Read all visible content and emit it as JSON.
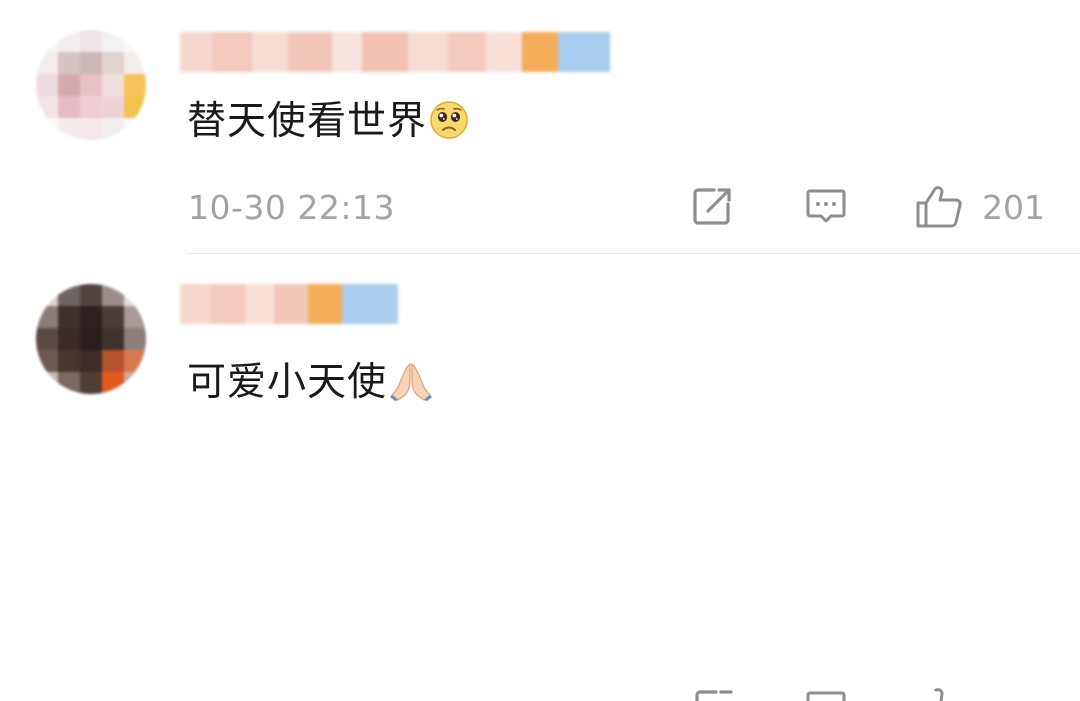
{
  "comments": [
    {
      "username": "",
      "text": "替天使看世界",
      "emoji": "pleading-face-emoji",
      "timestamp": "10-30 22:13",
      "likes": "201"
    },
    {
      "username": "",
      "text": "可爱小天使",
      "emoji": "folded-hands-emoji",
      "timestamp": "",
      "likes": ""
    }
  ],
  "icons": {
    "share": "share-icon",
    "reply": "comment-icon",
    "like": "thumbs-up-icon"
  },
  "colors": {
    "text": "#1a1a1a",
    "meta": "#a3a3a3",
    "divider": "#e8e8e8",
    "background": "#ffffff"
  }
}
